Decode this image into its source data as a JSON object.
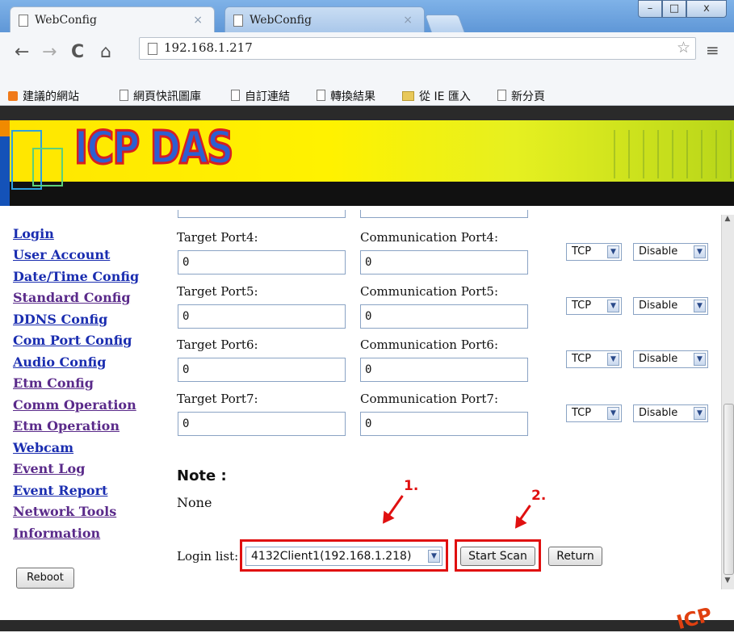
{
  "browser": {
    "tabs": [
      {
        "title": "WebConfig"
      },
      {
        "title": "WebConfig"
      }
    ],
    "url": "192.168.1.217",
    "bookmarks": [
      "建議的網站",
      "網頁快訊圖庫",
      "自訂連結",
      "轉換結果",
      "從 IE 匯入",
      "新分頁"
    ]
  },
  "banner": {
    "logo_text": "ICP DAS"
  },
  "sidebar": {
    "links": [
      "Login",
      "User Account",
      "Date/Time Config",
      "Standard Config",
      "DDNS Config",
      "Com Port Config",
      "Audio Config",
      "Etm Config",
      "Comm Operation",
      "Etm Operation",
      "Webcam",
      "Event Log",
      "Event Report",
      "Network Tools",
      "Information"
    ],
    "reboot": "Reboot"
  },
  "ports": [
    {
      "target_label": "Target Port4:",
      "comm_label": "Communication Port4:",
      "target_value": "0",
      "comm_value": "0",
      "protocol": "TCP",
      "state": "Disable"
    },
    {
      "target_label": "Target Port5:",
      "comm_label": "Communication Port5:",
      "target_value": "0",
      "comm_value": "0",
      "protocol": "TCP",
      "state": "Disable"
    },
    {
      "target_label": "Target Port6:",
      "comm_label": "Communication Port6:",
      "target_value": "0",
      "comm_value": "0",
      "protocol": "TCP",
      "state": "Disable"
    },
    {
      "target_label": "Target Port7:",
      "comm_label": "Communication Port7:",
      "target_value": "0",
      "comm_value": "0",
      "protocol": "TCP",
      "state": "Disable"
    }
  ],
  "note": {
    "title": "Note :",
    "body": "None"
  },
  "login": {
    "label": "Login list:",
    "selected": "4132Client1(192.168.1.218)",
    "start_scan": "Start Scan",
    "return": "Return"
  },
  "annotations": {
    "step1": "1.",
    "step2": "2."
  },
  "footer": {
    "logo_text": "ICP"
  },
  "colors": {
    "highlight": "#e01010",
    "link": "#1a2db0",
    "visited_link": "#5a2a8a",
    "banner_yellow": "#fff200"
  }
}
